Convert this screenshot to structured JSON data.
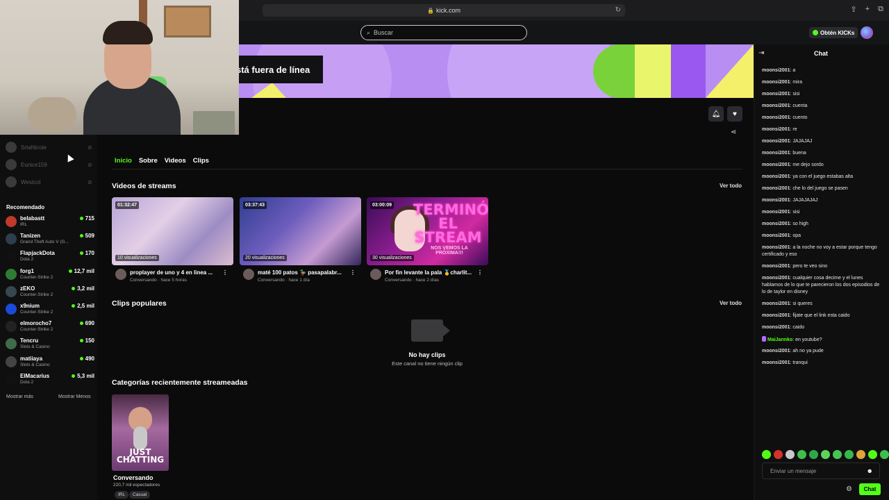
{
  "browser": {
    "url": "kick.com"
  },
  "header": {
    "search_placeholder": "Buscar",
    "kicks_label": "Obtén KICKs"
  },
  "channel": {
    "offline_banner": "stá fuera de línea"
  },
  "sidebar": {
    "following": [
      {
        "name": "SrtaNicole"
      },
      {
        "name": "Eunice159"
      },
      {
        "name": "Westcol"
      }
    ],
    "recommended_title": "Recomendado",
    "recommended": [
      {
        "name": "belabastt",
        "category": "IRL",
        "viewers": "715",
        "color": "#c0392b"
      },
      {
        "name": "Tanizen",
        "category": "Grand Theft Auto V (G...",
        "viewers": "509",
        "color": "#2c3e50"
      },
      {
        "name": "FlapjackDota",
        "category": "Dota 2",
        "viewers": "170",
        "color": "#111111"
      },
      {
        "name": "forg1",
        "category": "Counter-Strike 2",
        "viewers": "12,7 mil",
        "color": "#2e7d32"
      },
      {
        "name": "zEKO",
        "category": "Counter-Strike 2",
        "viewers": "3,2 mil",
        "color": "#37474f"
      },
      {
        "name": "x9nium",
        "category": "Counter-Strike 2",
        "viewers": "2,5 mil",
        "color": "#1a4ad8"
      },
      {
        "name": "elmorocho7",
        "category": "Counter-Strike 2",
        "viewers": "690",
        "color": "#222222"
      },
      {
        "name": "Tencru",
        "category": "Slots & Casino",
        "viewers": "150",
        "color": "#3f6b4a"
      },
      {
        "name": "matiiaya",
        "category": "Slots & Casino",
        "viewers": "490",
        "color": "#444444"
      },
      {
        "name": "ElMacarius",
        "category": "Dota 2",
        "viewers": "5,3 mil",
        "color": "#111111"
      }
    ],
    "show_more": "Mostrar más",
    "show_less": "Mostrar Menos"
  },
  "tabs": [
    "Inicio",
    "Sobre",
    "Videos",
    "Clips"
  ],
  "streams_section": {
    "title": "Videos de streams",
    "see_all": "Ver todo",
    "videos": [
      {
        "duration": "01:32:47",
        "views": "10 visualizaciones",
        "title": "proplayer de uno y 4 en linea ...",
        "category": "Conversando",
        "ago": "hace 5 horas"
      },
      {
        "duration": "03:37:43",
        "views": "20 visualizaciones",
        "title": "maté 100 patos 🦆 pasapalabr...",
        "category": "Conversando",
        "ago": "hace 1 día"
      },
      {
        "duration": "03:00:09",
        "views": "30 visualizaciones",
        "title": "Por fin levante la pala 🥇charlit...",
        "category": "Conversando",
        "ago": "hace 2 días",
        "art_text": "TERMINÓ EL STREAM",
        "art_sub": "NOS VEMOS LA PRÓXIMA!!!"
      }
    ]
  },
  "clips_section": {
    "title": "Clips populares",
    "see_all": "Ver todo",
    "empty_title": "No hay clips",
    "empty_sub": "Este canal no tiene ningún clip"
  },
  "categories_section": {
    "title": "Categorías recientemente streameadas",
    "category": {
      "art_text": "JUST CHATTING",
      "name": "Conversando",
      "viewers": "220,7 mil espectadores",
      "tags": [
        "IRL",
        "Casual"
      ]
    }
  },
  "chat": {
    "title": "Chat",
    "input_placeholder": "Enviar un mensaje",
    "send_label": "Chat",
    "messages": [
      {
        "user": "moonsi2001",
        "text": "a"
      },
      {
        "user": "moonsi2001",
        "text": "mira"
      },
      {
        "user": "moonsi2001",
        "text": "sisi"
      },
      {
        "user": "moonsi2001",
        "text": "cuenta"
      },
      {
        "user": "moonsi2001",
        "text": "cuento"
      },
      {
        "user": "moonsi2001",
        "text": "re"
      },
      {
        "user": "moonsi2001",
        "text": "JAJAJAJ"
      },
      {
        "user": "moonsi2001",
        "text": "buena"
      },
      {
        "user": "moonsi2001",
        "text": "me dejo sordo"
      },
      {
        "user": "moonsi2001",
        "text": "ya con el juego estabas alta"
      },
      {
        "user": "moonsi2001",
        "text": "che lo del juego se pasen"
      },
      {
        "user": "moonsi2001",
        "text": "JAJAJAJAJ"
      },
      {
        "user": "moonsi2001",
        "text": "sisi"
      },
      {
        "user": "moonsi2001",
        "text": "so high"
      },
      {
        "user": "moonsi2001",
        "text": "opa"
      },
      {
        "user": "moonsi2001",
        "text": "a la noche no voy a estar porque tengo certificado y eso"
      },
      {
        "user": "moonsi2001",
        "text": "pero te veo sino"
      },
      {
        "user": "moonsi2001",
        "text": "cualquier cosa decime y el lunes hablamos de lo que te parecieron los dos episodios de lo de taylor en disney"
      },
      {
        "user": "moonsi2001",
        "text": "si queres"
      },
      {
        "user": "moonsi2001",
        "text": "fijate que el link esta caido"
      },
      {
        "user": "moonsi2001",
        "text": "caido"
      },
      {
        "user": "MaiJannko",
        "text": "en youtube?",
        "highlight": true
      },
      {
        "user": "moonsi2001",
        "text": "ah no ya pude"
      },
      {
        "user": "moonsi2001",
        "text": "tranqui"
      }
    ]
  },
  "colors": {
    "accent": "#53fc18",
    "banner": "#b88ef3"
  }
}
